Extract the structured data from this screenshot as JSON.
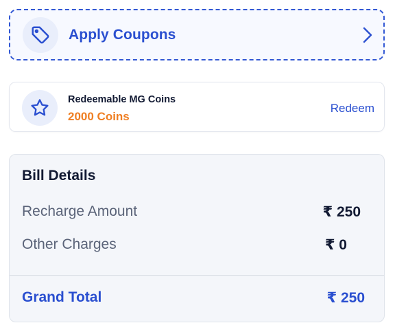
{
  "coupon": {
    "label": "Apply Coupons",
    "icon": "tag-icon",
    "action_icon": "chevron-right-icon"
  },
  "coins": {
    "label": "Redeemable MG Coins",
    "value": "2000 Coins",
    "action_label": "Redeem",
    "icon": "star-icon"
  },
  "bill": {
    "title": "Bill Details",
    "rows": [
      {
        "label": "Recharge Amount",
        "value": "₹ 250"
      },
      {
        "label": "Other Charges",
        "value": "₹ 0"
      }
    ],
    "grand_total": {
      "label": "Grand Total",
      "value": "₹ 250"
    }
  },
  "colors": {
    "accent": "#2a4fd0",
    "coins_value": "#ef7e22",
    "text_dark": "#121a33",
    "text_muted": "#5b6479",
    "icon_bg": "#e9eefb"
  }
}
